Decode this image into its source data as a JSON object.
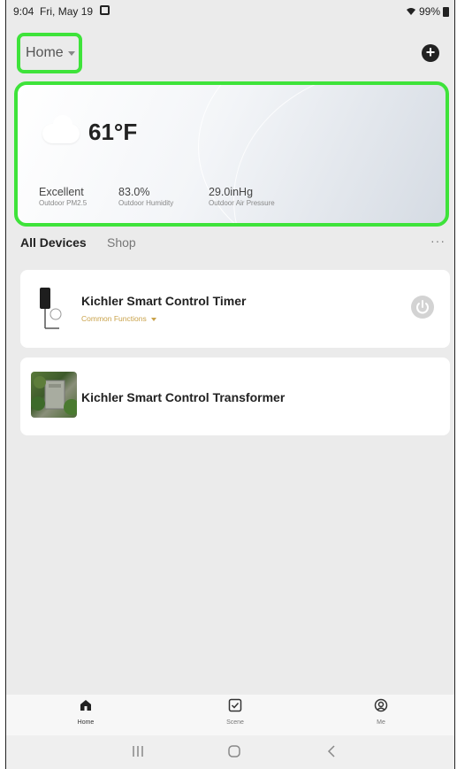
{
  "status_bar": {
    "time": "9:04",
    "date": "Fri, May 19",
    "battery": "99%"
  },
  "header": {
    "home_label": "Home",
    "add_icon": "plus-circle-icon"
  },
  "weather": {
    "condition_icon": "cloud-icon",
    "temperature": "61°F",
    "metrics": [
      {
        "value": "Excellent",
        "label": "Outdoor PM2.5"
      },
      {
        "value": "83.0%",
        "label": "Outdoor Humidity"
      },
      {
        "value": "29.0inHg",
        "label": "Outdoor Air Pressure"
      }
    ]
  },
  "tabs": {
    "all_devices": "All Devices",
    "shop": "Shop",
    "more": "···"
  },
  "devices": [
    {
      "name": "Kichler Smart Control Timer",
      "subtitle": "Common Functions",
      "has_power": true
    },
    {
      "name": "Kichler Smart Control Transformer"
    }
  ],
  "bottom_nav": [
    {
      "label": "Home",
      "icon": "home-icon",
      "active": true
    },
    {
      "label": "Scene",
      "icon": "checkbox-icon",
      "active": false
    },
    {
      "label": "Me",
      "icon": "user-circle-icon",
      "active": false
    }
  ],
  "colors": {
    "highlight_green": "#3ee33a",
    "accent_gold": "#c9a24a",
    "background": "#ebebeb"
  }
}
